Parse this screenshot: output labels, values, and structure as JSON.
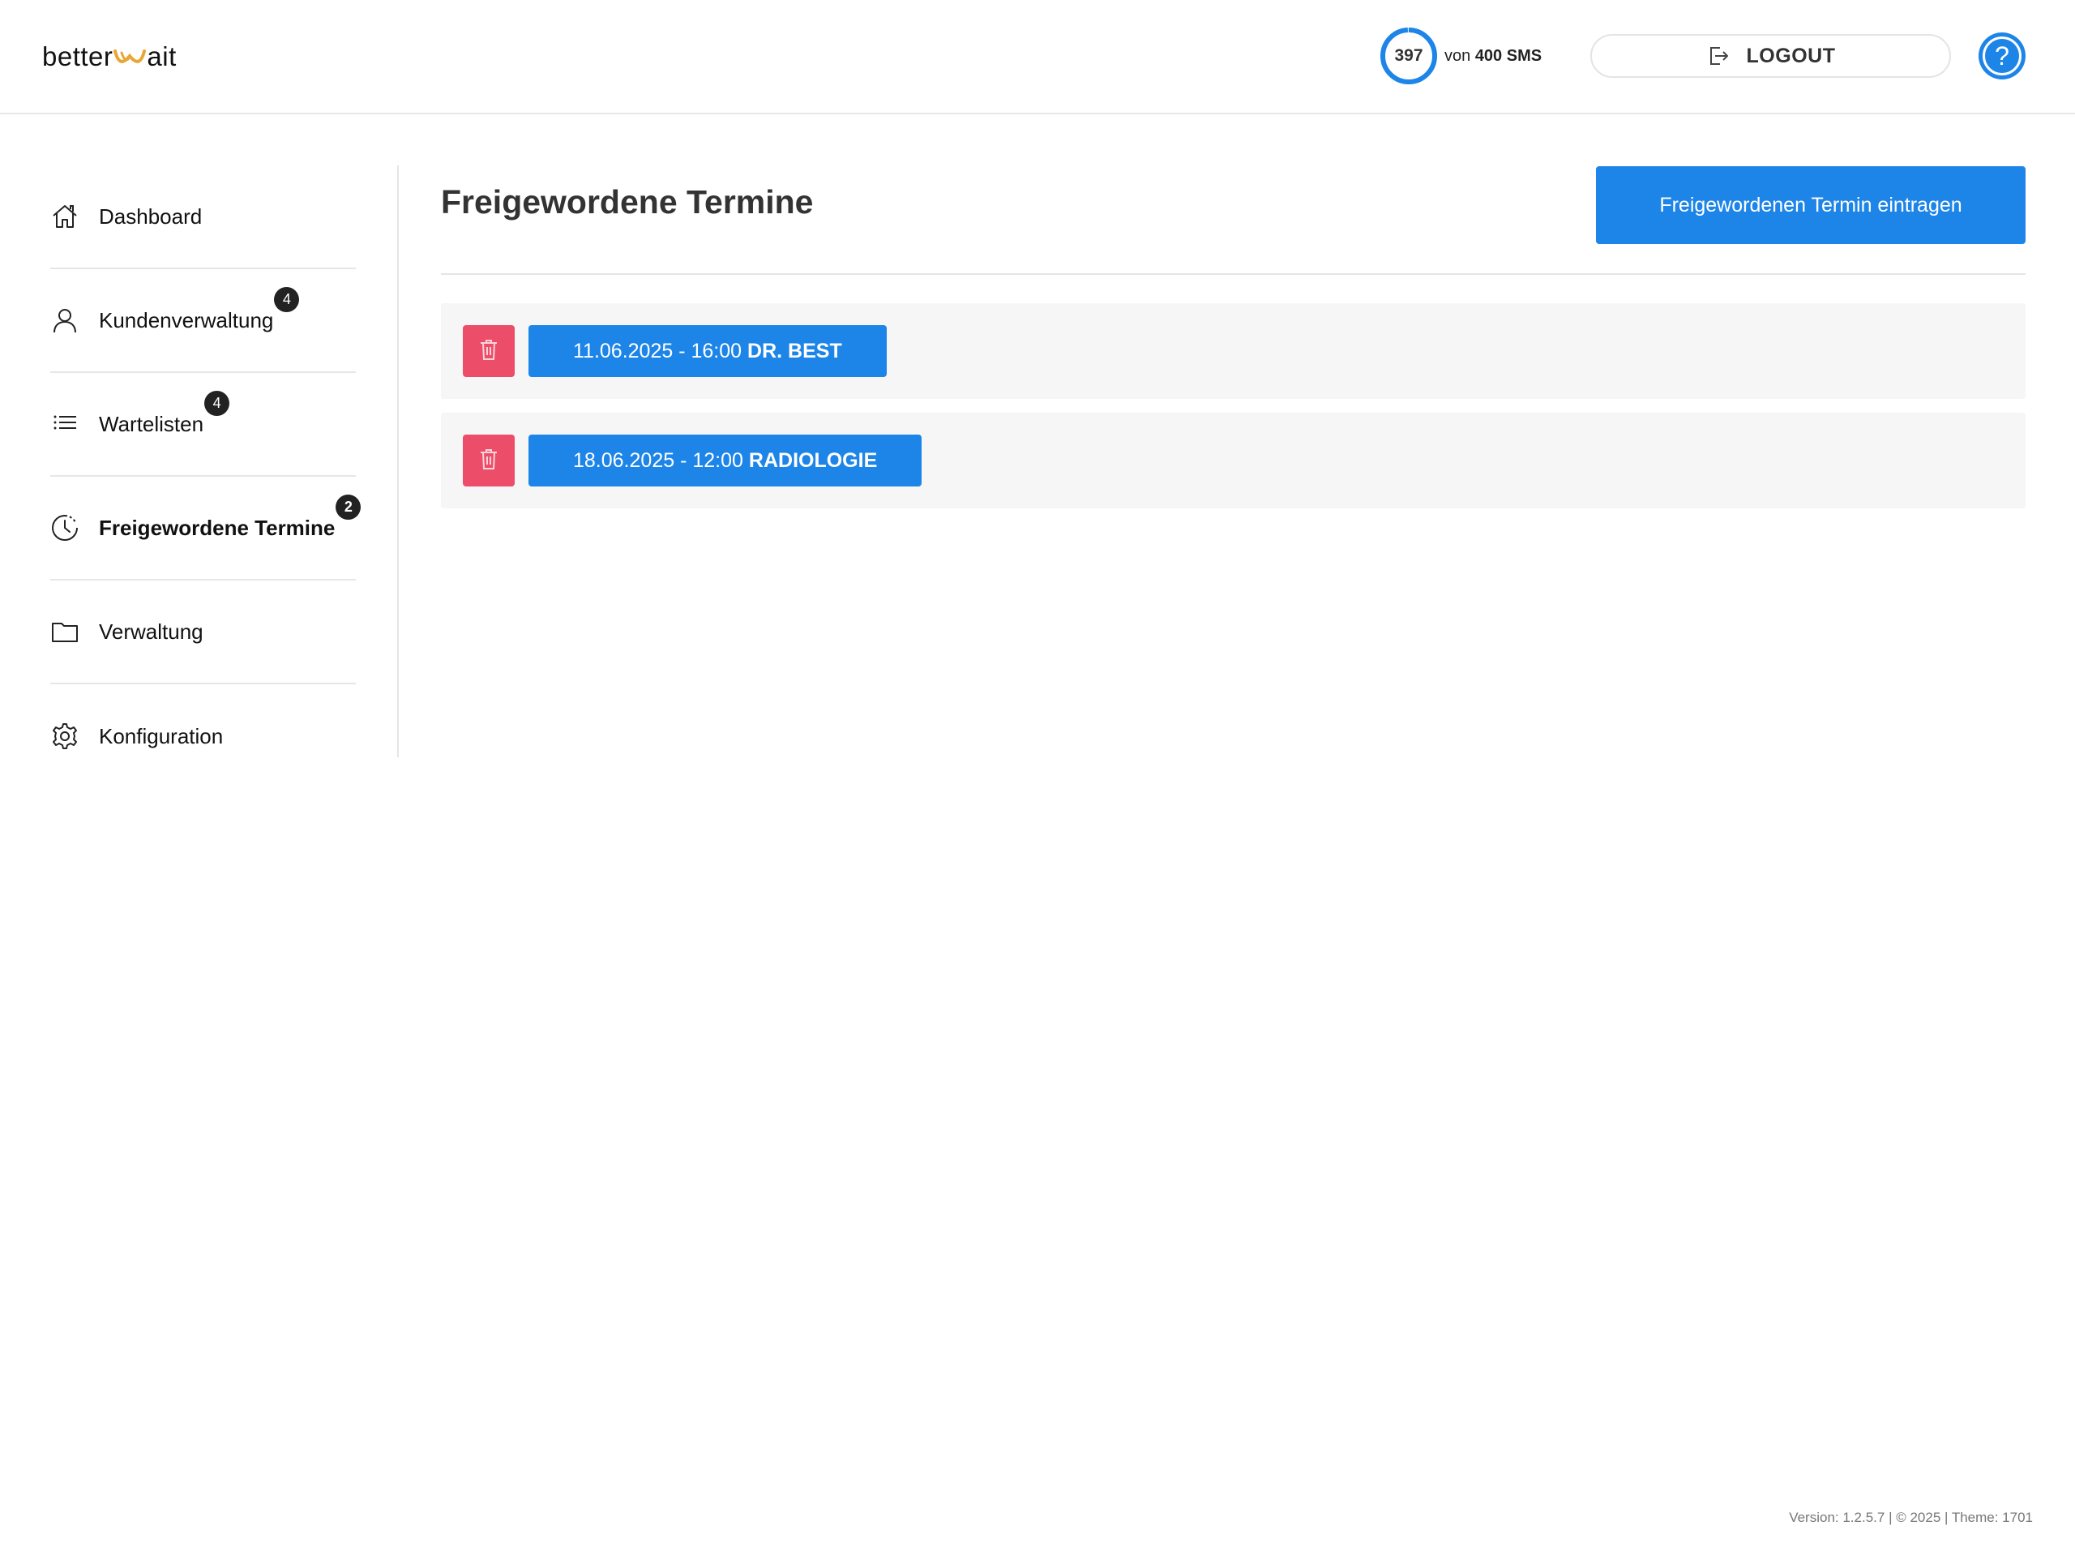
{
  "header": {
    "logo": {
      "part1": "better",
      "part2": "ait"
    },
    "sms": {
      "used": "397",
      "prefix": "von",
      "total": "400 SMS",
      "used_fraction": 0.9925
    },
    "logout_label": "LOGOUT",
    "help_label": "?"
  },
  "sidebar": {
    "items": [
      {
        "label": "Dashboard",
        "icon": "home-icon",
        "badge": ""
      },
      {
        "label": "Kundenverwaltung",
        "icon": "user-icon",
        "badge": "4"
      },
      {
        "label": "Wartelisten",
        "icon": "list-icon",
        "badge": "4"
      },
      {
        "label": "Freigewordene Termine",
        "icon": "clock-icon",
        "badge": "2",
        "active": true
      },
      {
        "label": "Verwaltung",
        "icon": "folder-icon",
        "badge": ""
      },
      {
        "label": "Konfiguration",
        "icon": "gear-icon",
        "badge": ""
      }
    ]
  },
  "main": {
    "title": "Freigewordene Termine",
    "add_button_label": "Freigewordenen Termin eintragen",
    "appointments": [
      {
        "datetime": "11.06.2025 - 16:00",
        "location": "DR. BEST"
      },
      {
        "datetime": "18.06.2025 - 12:00",
        "location": "RADIOLOGIE"
      }
    ]
  },
  "footer": {
    "version_text": "Version: 1.2.5.7 | © 2025 | Theme: 1701"
  },
  "colors": {
    "primary": "#1d85e8",
    "danger": "#ec4e69",
    "logo_accent": "#e8a634",
    "badge": "#222222"
  }
}
